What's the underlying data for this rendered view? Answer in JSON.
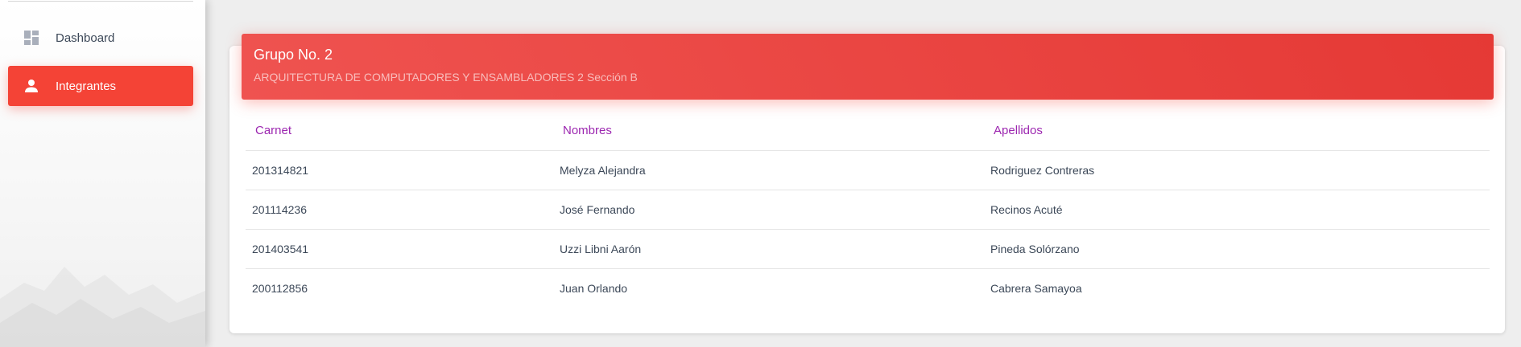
{
  "sidebar": {
    "items": [
      {
        "label": "Dashboard",
        "icon": "dashboard-icon",
        "active": false
      },
      {
        "label": "Integrantes",
        "icon": "person-icon",
        "active": true
      }
    ]
  },
  "card": {
    "title": "Grupo No. 2",
    "subtitle": "ARQUITECTURA DE COMPUTADORES Y ENSAMBLADORES 2 Sección B",
    "header_color": "#e53935"
  },
  "table": {
    "headers": [
      "Carnet",
      "Nombres",
      "Apellidos"
    ],
    "rows": [
      [
        "201314821",
        "Melyza Alejandra",
        "Rodriguez Contreras"
      ],
      [
        "201114236",
        "José Fernando",
        "Recinos Acuté"
      ],
      [
        "201403541",
        "Uzzi Libni Aarón",
        "Pineda Solórzano"
      ],
      [
        "200112856",
        "Juan Orlando",
        "Cabrera Samayoa"
      ]
    ],
    "header_color": "#9c27b0"
  },
  "colors": {
    "accent": "#f44336",
    "background": "#eeeeee"
  }
}
